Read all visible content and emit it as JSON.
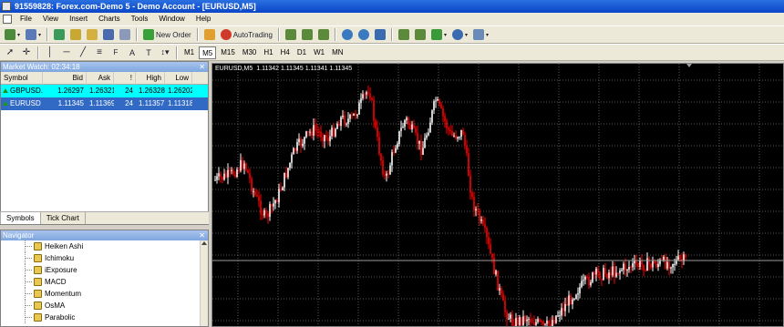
{
  "window": {
    "title": "91559828: Forex.com-Demo 5 - Demo Account - [EURUSD,M5]"
  },
  "menu": [
    "File",
    "View",
    "Insert",
    "Charts",
    "Tools",
    "Window",
    "Help"
  ],
  "toolbar": {
    "new_order_label": "New Order",
    "autotrading_label": "AutoTrading"
  },
  "timeframes": [
    "M1",
    "M5",
    "M15",
    "M30",
    "H1",
    "H4",
    "D1",
    "W1",
    "MN"
  ],
  "active_timeframe": "M5",
  "market_watch": {
    "title": "Market Watch: 02:34:18",
    "headers": [
      "Symbol",
      "Bid",
      "Ask",
      "!",
      "High",
      "Low"
    ],
    "rows": [
      {
        "symbol": "GBPUSD...",
        "bid": "1.26297",
        "ask": "1.26321",
        "spread": "24",
        "high": "1.26328",
        "low": "1.26202",
        "highlight": "#00ffff"
      },
      {
        "symbol": "EURUSD",
        "bid": "1.11345",
        "ask": "1.11369",
        "spread": "24",
        "high": "1.11357",
        "low": "1.11318",
        "highlight": "#316ac5"
      }
    ],
    "tabs": [
      "Symbols",
      "Tick Chart"
    ]
  },
  "navigator": {
    "title": "Navigator",
    "items": [
      "Heiken Ashi",
      "Ichimoku",
      "iExposure",
      "MACD",
      "Momentum",
      "OsMA",
      "Parabolic"
    ]
  },
  "chart": {
    "header_symbol": "EURUSD,M5",
    "header_ohlc": "1.11342 1.11345 1.11341 1.11345",
    "up_color": "#ffffff",
    "down_color": "#ff0000",
    "grid": true,
    "type": "candlestick"
  }
}
